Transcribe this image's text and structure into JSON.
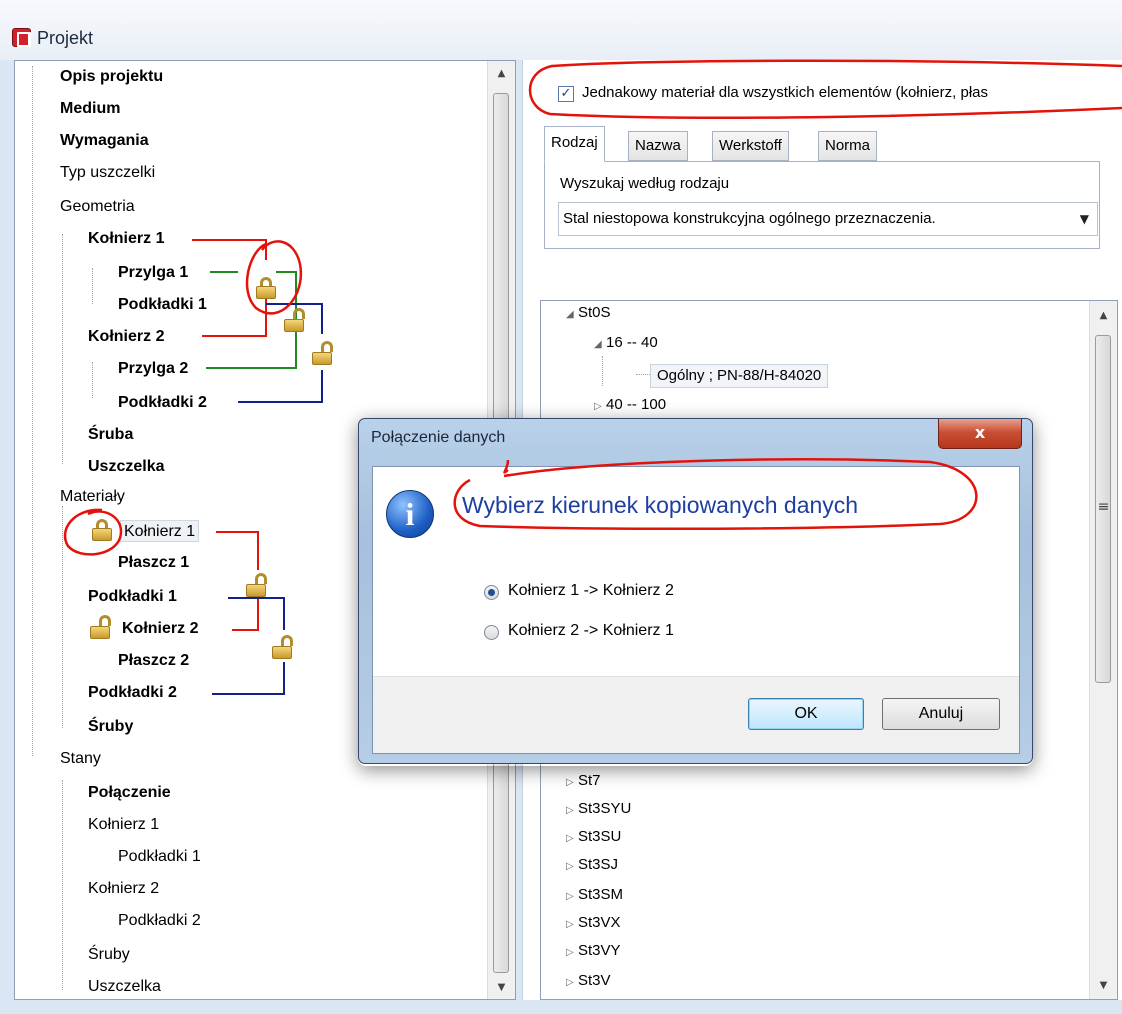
{
  "window": {
    "title": "Projekt",
    "app_icon": "app-logo-icon"
  },
  "project_tree": {
    "items": [
      {
        "label": "Opis projektu",
        "bold": true
      },
      {
        "label": "Medium",
        "bold": true
      },
      {
        "label": "Wymagania",
        "bold": true
      },
      {
        "label": "Typ uszczelki",
        "bold": false
      },
      {
        "label": "Geometria",
        "bold": false
      },
      {
        "label": "Kołnierz 1",
        "bold": true
      },
      {
        "label": "Przylga 1",
        "bold": true
      },
      {
        "label": "Podkładki 1",
        "bold": true
      },
      {
        "label": "Kołnierz 2",
        "bold": true
      },
      {
        "label": "Przylga 2",
        "bold": true
      },
      {
        "label": "Podkładki 2",
        "bold": true
      },
      {
        "label": "Śruba",
        "bold": true
      },
      {
        "label": "Uszczelka",
        "bold": true
      },
      {
        "label": "Materiały",
        "bold": false
      },
      {
        "label": "Kołnierz 1",
        "bold": false
      },
      {
        "label": "Płaszcz 1",
        "bold": true
      },
      {
        "label": "Podkładki 1",
        "bold": true
      },
      {
        "label": "Kołnierz 2",
        "bold": true
      },
      {
        "label": "Płaszcz 2",
        "bold": true
      },
      {
        "label": "Podkładki 2",
        "bold": true
      },
      {
        "label": "Śruby",
        "bold": true
      },
      {
        "label": "Stany",
        "bold": false
      },
      {
        "label": "Połączenie",
        "bold": true
      },
      {
        "label": "Kołnierz 1",
        "bold": false
      },
      {
        "label": "Podkładki 1",
        "bold": false
      },
      {
        "label": "Kołnierz 2",
        "bold": false
      },
      {
        "label": "Podkładki 2",
        "bold": false
      },
      {
        "label": "Śruby",
        "bold": false
      },
      {
        "label": "Uszczelka",
        "bold": false
      }
    ]
  },
  "material_panel": {
    "same_material_checkbox": {
      "label": "Jednakowy materiał dla wszystkich elementów (kołnierz, płas",
      "checked": true,
      "check_glyph": "✓"
    },
    "tabs": [
      "Rodzaj",
      "Nazwa",
      "Werkstoff",
      "Norma"
    ],
    "active_tab": "Rodzaj",
    "search_label": "Wyszukaj według rodzaju",
    "search_value": "Stal niestopowa konstrukcyjna ogólnego przeznaczenia.",
    "tree": {
      "root": "St0S",
      "child_range_1": "16 -- 40",
      "child_leaf": "Ogólny ; PN-88/H-84020",
      "child_range_2": "40 -- 100",
      "other_grades": [
        "St7",
        "St3SYU",
        "St3SU",
        "St3SJ",
        "St3SM",
        "St3VX",
        "St3VY",
        "St3V"
      ]
    }
  },
  "dialog": {
    "title": "Połączenie danych",
    "close_glyph": "x",
    "icon": "info-icon",
    "icon_glyph": "i",
    "heading": "Wybierz kierunek kopiowanych danych",
    "options": [
      {
        "label": "Kołnierz 1 -> Kołnierz 2",
        "selected": true
      },
      {
        "label": "Kołnierz 2 -> Kołnierz 1",
        "selected": false
      }
    ],
    "ok_label": "OK",
    "cancel_label": "Anuluj"
  },
  "glyphs": {
    "expanded": "◢",
    "collapsed": "▷",
    "dropdown": "▼",
    "scroll_up": "▲",
    "scroll_down": "▼",
    "grip": "≡"
  },
  "colors": {
    "annotation_red": "#e3120b",
    "link_red": "#e3120b",
    "link_green": "#1f8a1f",
    "link_blue": "#12228c",
    "heading_blue": "#1f3fa0"
  }
}
